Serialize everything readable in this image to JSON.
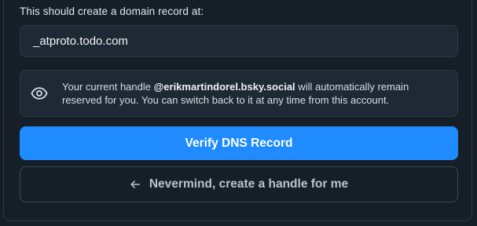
{
  "instructions": {
    "label": "This should create a domain record at:"
  },
  "domain_record": {
    "value": "_atproto.todo.com"
  },
  "notice": {
    "icon": "eye-icon",
    "text_before": "Your current handle ",
    "handle": "@erikmartindorel.bsky.social",
    "text_after": " will automatically remain reserved for you. You can switch back to it at any time from this account."
  },
  "actions": {
    "verify_label": "Verify DNS Record",
    "back_icon": "arrow-left-icon",
    "back_label": "Nevermind, create a handle for me"
  },
  "colors": {
    "background": "#161e27",
    "surface": "#1e2935",
    "border": "#2c3a48",
    "accent": "#208bfe"
  }
}
